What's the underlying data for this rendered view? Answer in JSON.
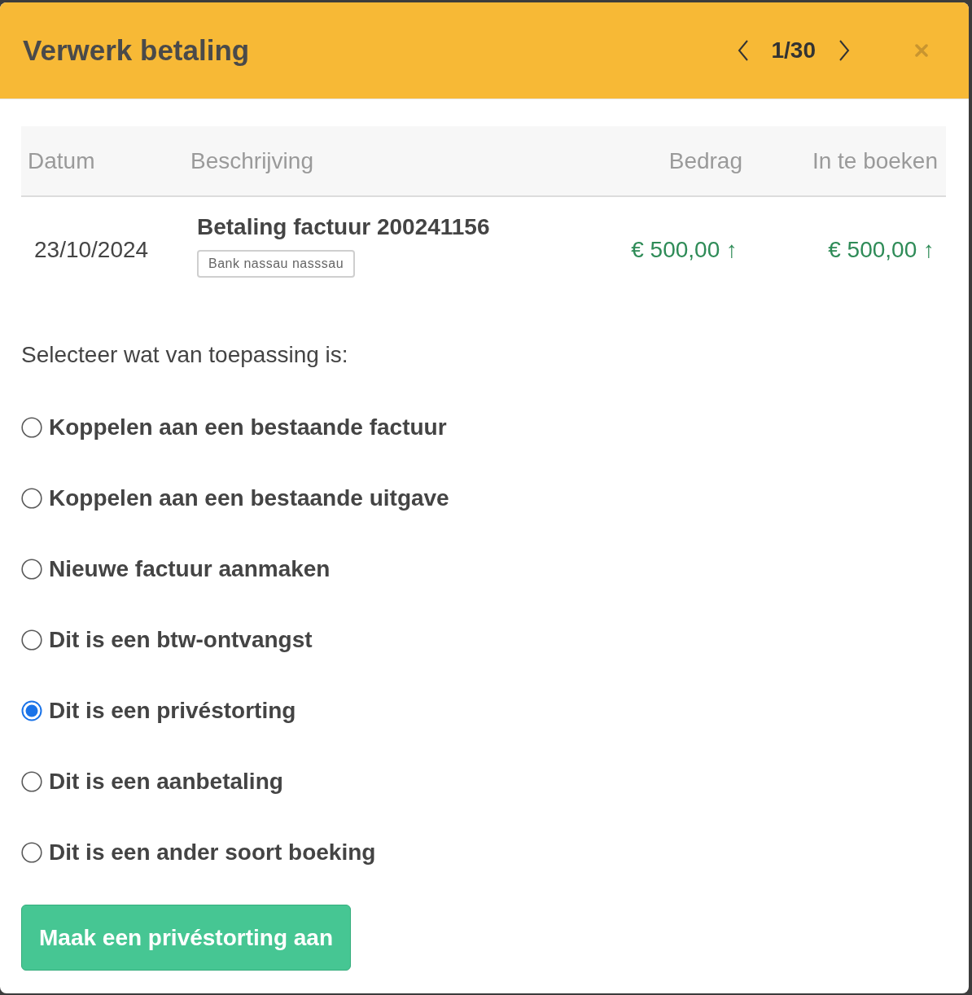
{
  "dialog": {
    "title": "Verwerk betaling",
    "pager": {
      "position": "1/30"
    }
  },
  "table": {
    "columns": [
      "Datum",
      "Beschrijving",
      "Bedrag",
      "In te boeken"
    ],
    "rows": [
      {
        "date": "23/10/2024",
        "description": "Betaling factuur 200241156",
        "account_tag": "Bank nassau nasssau",
        "amount": "€ 500,00 ↑",
        "to_book": "€ 500,00 ↑"
      }
    ]
  },
  "prompt": "Selecteer wat van toepassing is:",
  "options": [
    {
      "label": "Koppelen aan een bestaande factuur",
      "selected": false
    },
    {
      "label": "Koppelen aan een bestaande uitgave",
      "selected": false
    },
    {
      "label": "Nieuwe factuur aanmaken",
      "selected": false
    },
    {
      "label": "Dit is een btw-ontvangst",
      "selected": false
    },
    {
      "label": "Dit is een privéstorting",
      "selected": true
    },
    {
      "label": "Dit is een aanbetaling",
      "selected": false
    },
    {
      "label": "Dit is een ander soort boeking",
      "selected": false
    }
  ],
  "submit_button": "Maak een privéstorting aan"
}
